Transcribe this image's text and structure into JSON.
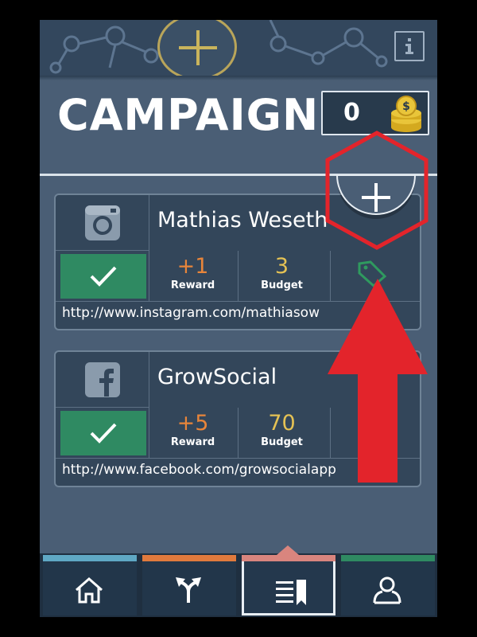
{
  "header": {
    "add_icon": "plus-icon",
    "info_icon": "info-icon"
  },
  "page": {
    "title": "CAMPAIGN",
    "coins": "0",
    "coins_icon": "coin-stack-icon"
  },
  "campaigns": [
    {
      "name": "Mathias Weseth",
      "platform_icon": "instagram-icon",
      "reward_value": "+1",
      "reward_label": "Reward",
      "budget_value": "3",
      "budget_label": "Budget",
      "url": "http://www.instagram.com/mathiasow"
    },
    {
      "name": "GrowSocial",
      "platform_icon": "facebook-icon",
      "reward_value": "+5",
      "reward_label": "Reward",
      "budget_value": "70",
      "budget_label": "Budget",
      "url": "http://www.facebook.com/growsocialapp"
    }
  ],
  "nav": [
    {
      "icon": "home-icon",
      "color": "#5fa8c4"
    },
    {
      "icon": "directions-icon",
      "color": "#e07a3d"
    },
    {
      "icon": "campaign-list-icon",
      "color": "#d9857e",
      "active": true
    },
    {
      "icon": "profile-icon",
      "color": "#2f8a62"
    }
  ],
  "colors": {
    "background": "#4a5e75",
    "card": "#33465a",
    "check_green": "#2f8a62",
    "reward_orange": "#e8853a",
    "budget_yellow": "#e5c254",
    "highlight_red": "#e3242b"
  }
}
